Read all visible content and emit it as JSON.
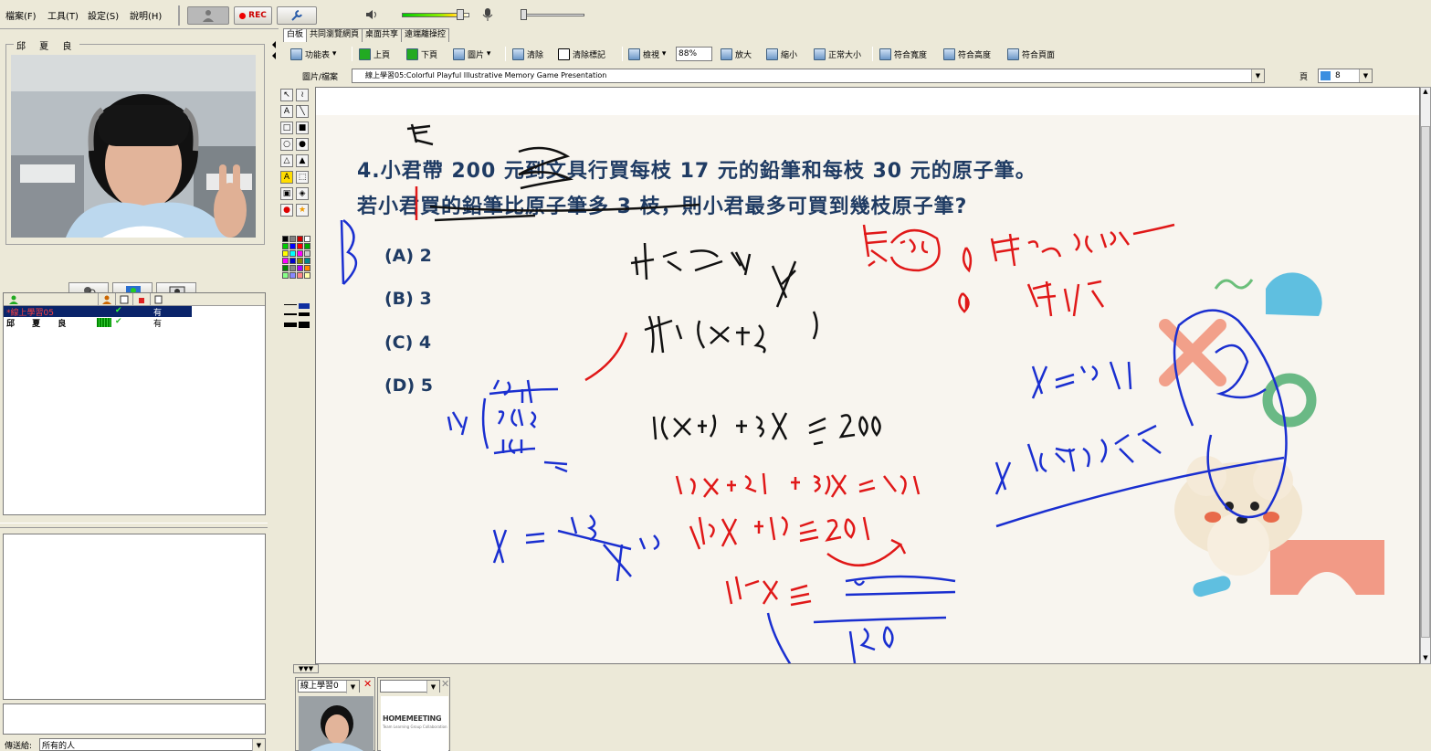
{
  "menu": {
    "items": [
      "檔案(F)",
      "工具(T)",
      "設定(S)",
      "說明(H)"
    ],
    "rec_label": "REC"
  },
  "left_panel": {
    "camera_user": "邱 夏 良",
    "users": [
      {
        "name": "*線上學習05",
        "status": "有"
      },
      {
        "name": "邱 夏 良",
        "status": "有"
      }
    ],
    "send_to_label": "傳送給:",
    "send_to_value": "所有的人"
  },
  "tabs": [
    "白板",
    "共同瀏覽網頁",
    "桌面共享",
    "遠端離操控"
  ],
  "toolbar": {
    "menu": "功能表",
    "prev": "上頁",
    "next": "下頁",
    "image": "圖片",
    "clear": "清除",
    "clear_marks": "清除標記",
    "view": "檢視",
    "zoom_value": "88%",
    "zoom_in": "放大",
    "zoom_out": "縮小",
    "actual_size": "正常大小",
    "fit_width": "符合寬度",
    "fit_height": "符合高度",
    "fit_page": "符合頁面"
  },
  "file_bar": {
    "label": "圖片/檔案",
    "value": "線上學習05:Colorful Playful Illustrative Memory Game Presentation",
    "page_label": "頁",
    "page_value": "8"
  },
  "slide": {
    "question_line1": "4.小君帶 200 元到文具行買每枝 17 元的鉛筆和每枝 30 元的原子筆。",
    "question_line2": "若小君買的鉛筆比原子筆多 3 枝，則小君最多可買到幾枝原子筆?",
    "options": [
      "(A) 2",
      "(B) 3",
      "(C) 4",
      "(D) 5"
    ]
  },
  "bottom": {
    "thumb_label": "線上學習0",
    "logo_text": "HOMEMEETING",
    "logo_sub": "Team Learning Group Collaboration"
  },
  "colors": {
    "ink_blue": "#1a2fd0",
    "ink_red": "#e01818",
    "ink_black": "#111111",
    "slide_text": "#1f3b63"
  }
}
